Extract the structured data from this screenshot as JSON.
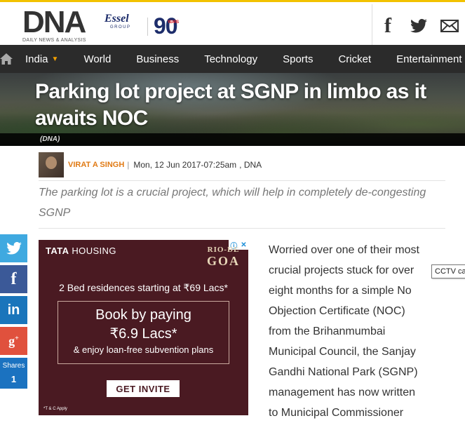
{
  "header": {
    "logo_text": "DNA",
    "logo_subtitle": "DAILY NEWS & ANALYSIS",
    "partner_name": "Essel",
    "partner_sub": "GROUP",
    "anniversary": "90",
    "anniversary_label": "YEARS"
  },
  "nav": {
    "items": [
      {
        "label": "India"
      },
      {
        "label": "World"
      },
      {
        "label": "Business"
      },
      {
        "label": "Technology"
      },
      {
        "label": "Sports"
      },
      {
        "label": "Cricket"
      },
      {
        "label": "Entertainment"
      }
    ]
  },
  "article": {
    "title": "Parking lot project at SGNP in limbo as it awaits NOC",
    "image_credit": "(DNA)",
    "author": "VIRAT A SINGH",
    "separator": "|",
    "date": "Mon, 12 Jun 2017-07:25am",
    "source": ", DNA",
    "summary": "The parking lot is a crucial project, which will help in completely de-congesting SGNP",
    "body_lines": [
      "Worried over one of their most",
      "crucial projects stuck for over",
      "eight months for a simple No",
      "Objection Certificate (NOC)",
      "from the Brihanmumbai",
      "Municipal Council, the Sanjay",
      "Gandhi National Park (SGNP)",
      "management has now written",
      "to Municipal Commissioner"
    ]
  },
  "share": {
    "label": "Shares",
    "count": "1"
  },
  "ad": {
    "brand": "TATA",
    "brand_suffix": "HOUSING",
    "project_line1": "RIO-DE",
    "project_line2": "GOA",
    "headline": "2 Bed residences starting at ₹69 Lacs*",
    "box_line1": "Book by paying",
    "box_line2": "₹6.9 Lacs*",
    "box_line3": "& enjoy loan-free subvention plans",
    "cta": "GET INVITE",
    "terms": "*T & C Apply"
  },
  "tooltip": "CCTV ca",
  "colors": {
    "accent": "#f2c200",
    "nav_bg": "#2b2b2b",
    "author": "#e07a14",
    "twitter": "#3fa9e0",
    "facebook": "#3b5998",
    "linkedin": "#1a75bb",
    "google": "#e0513d",
    "shares": "#1b72c0",
    "ad_bg": "#4a1a22"
  }
}
